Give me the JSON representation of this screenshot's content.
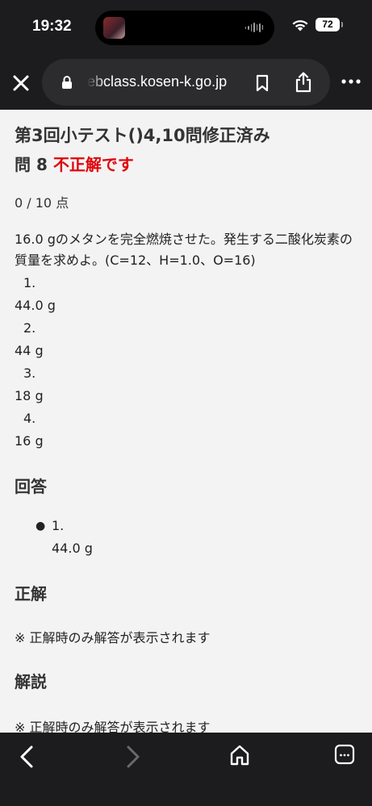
{
  "status": {
    "time": "19:32",
    "battery": "72"
  },
  "toolbar": {
    "url": "ebclass.kosen-k.go.jp"
  },
  "content": {
    "title": "第3回小テスト()4,10問修正済み",
    "question_label": "問 8",
    "question_result": "不正解です",
    "score": "0 / 10 点",
    "question_text": "16.0 gのメタンを完全燃焼させた。発生する二酸化炭素の質量を求めよ。(C=12、H=1.0、O=16)",
    "options": [
      {
        "num": "1.",
        "text": "44.0 g"
      },
      {
        "num": "2.",
        "text": "44 g"
      },
      {
        "num": "3.",
        "text": "18 g"
      },
      {
        "num": "4.",
        "text": "16 g"
      }
    ],
    "answer_heading": "回答",
    "answer": {
      "bullet": "●",
      "num": "1.",
      "text": "44.0 g"
    },
    "correct_heading": "正解",
    "correct_note": "※ 正解時のみ解答が表示されます",
    "explanation_heading": "解説",
    "explanation_note": "※ 正解時のみ解答が表示されます"
  },
  "icons": {
    "close": "close-icon",
    "lock": "lock-icon",
    "bookmark": "bookmark-icon",
    "share": "share-icon",
    "more": "more-icon",
    "back": "back-icon",
    "forward": "forward-icon",
    "home": "home-icon",
    "tabs": "tabs-icon"
  },
  "colors": {
    "result_red": "#e0040b",
    "chrome_dark": "#1c1c1e",
    "page_bg": "#f3f3f3"
  }
}
